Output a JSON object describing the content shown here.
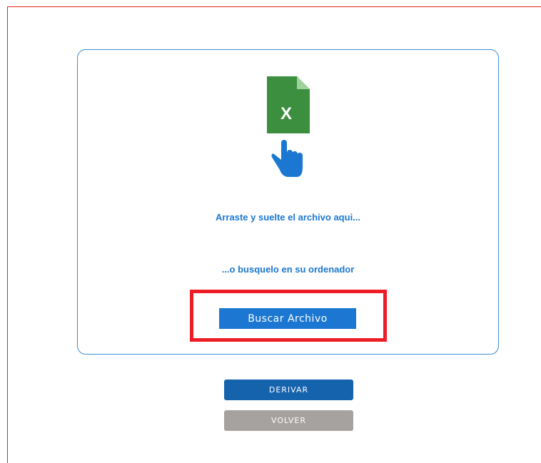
{
  "upload": {
    "file_icon": "excel-file-icon",
    "file_icon_letter": "X",
    "pointer_icon": "hand-pointer-icon",
    "drop_text": "Arraste y suelte el archivo aqui...",
    "browse_text": "...o busquelo en su ordenador",
    "browse_button_label": "Buscar Archivo"
  },
  "actions": {
    "derive_label": "DERIVAR",
    "back_label": "VOLVER"
  },
  "colors": {
    "primary_blue": "#1b77d1",
    "derive_blue": "#1562ad",
    "back_gray": "#a6a2a0",
    "highlight_red": "#ee1c24",
    "excel_green": "#3d8f40"
  }
}
